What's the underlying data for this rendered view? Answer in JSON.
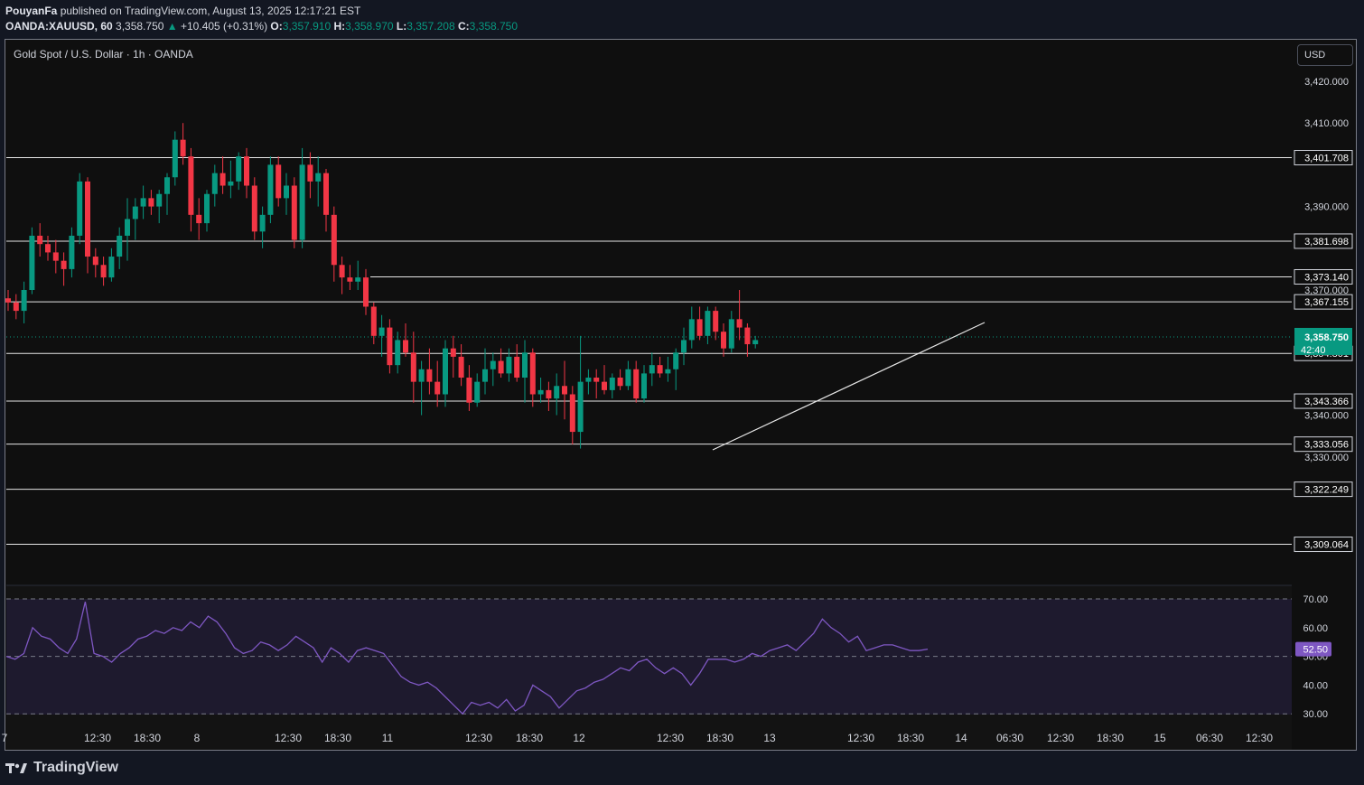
{
  "header": {
    "publisher": "PouyanFa",
    "published_text": "published on TradingView.com, August 13, 2025 12:17:21 EST",
    "symbol": "OANDA:XAUUSD, 60",
    "last": "3,358.750",
    "change": "+10.405 (+0.31%)",
    "o_label": "O:",
    "o": "3,357.910",
    "h_label": "H:",
    "h": "3,358.970",
    "l_label": "L:",
    "l": "3,357.208",
    "c_label": "C:",
    "c": "3,358.750"
  },
  "legend": "Gold Spot / U.S. Dollar · 1h · OANDA",
  "currency_button": "USD",
  "brand": "TradingView",
  "colors": {
    "up": "#089981",
    "down": "#f23645",
    "rsi": "#7e57c2",
    "rsi_badge": "#7e57c2",
    "price_badge": "#089981"
  },
  "chart_data": {
    "type": "candlestick",
    "price_axis": {
      "min": 3300,
      "max": 3428,
      "ticks": [
        "3,420.000",
        "3,410.000",
        "3,390.000",
        "3,370.000",
        "3,340.000",
        "3,330.000"
      ]
    },
    "horizontal_levels": [
      3401.708,
      3381.698,
      3373.14,
      3367.155,
      3354.801,
      3343.366,
      3333.056,
      3322.249,
      3309.064
    ],
    "level_labels": [
      "3,401.708",
      "3,381.698",
      "3,373.140",
      "3,367.155",
      "3,354.801",
      "3,343.366",
      "3,333.056",
      "3,322.249",
      "3,309.064"
    ],
    "last_price": 3358.75,
    "last_price_label": "3,358.750",
    "countdown": "42:40",
    "trendline": {
      "from": [
        "13 18:30",
        3332
      ],
      "to": [
        "14 ~03:00",
        3363
      ]
    },
    "x_ticks": [
      "7",
      "12:30",
      "18:30",
      "8",
      "12:30",
      "18:30",
      "11",
      "12:30",
      "18:30",
      "12",
      "12:30",
      "18:30",
      "13",
      "12:30",
      "18:30",
      "14",
      "06:30",
      "12:30",
      "18:30",
      "15",
      "06:30",
      "12:30"
    ],
    "candles": [
      [
        3368,
        3370,
        3365,
        3367
      ],
      [
        3367,
        3369,
        3363,
        3365
      ],
      [
        3365,
        3372,
        3362,
        3370
      ],
      [
        3370,
        3385,
        3369,
        3383
      ],
      [
        3383,
        3386,
        3378,
        3381
      ],
      [
        3381,
        3383,
        3377,
        3379
      ],
      [
        3379,
        3382,
        3374,
        3377
      ],
      [
        3377,
        3379,
        3371,
        3375
      ],
      [
        3375,
        3385,
        3373,
        3383
      ],
      [
        3383,
        3398,
        3381,
        3396
      ],
      [
        3396,
        3397,
        3374,
        3378
      ],
      [
        3378,
        3380,
        3373,
        3376
      ],
      [
        3376,
        3378,
        3371,
        3373
      ],
      [
        3373,
        3380,
        3372,
        3378
      ],
      [
        3378,
        3385,
        3375,
        3383
      ],
      [
        3383,
        3392,
        3377,
        3387
      ],
      [
        3387,
        3392,
        3382,
        3390
      ],
      [
        3390,
        3395,
        3387,
        3392
      ],
      [
        3392,
        3394,
        3388,
        3390
      ],
      [
        3390,
        3394,
        3386,
        3393
      ],
      [
        3393,
        3398,
        3388,
        3397
      ],
      [
        3397,
        3408,
        3395,
        3406
      ],
      [
        3406,
        3410,
        3400,
        3402
      ],
      [
        3402,
        3404,
        3384,
        3388
      ],
      [
        3388,
        3392,
        3382,
        3386
      ],
      [
        3386,
        3394,
        3384,
        3393
      ],
      [
        3393,
        3400,
        3390,
        3398
      ],
      [
        3398,
        3402,
        3393,
        3395
      ],
      [
        3395,
        3401,
        3392,
        3396
      ],
      [
        3396,
        3403,
        3394,
        3402
      ],
      [
        3402,
        3404,
        3392,
        3395
      ],
      [
        3395,
        3397,
        3382,
        3384
      ],
      [
        3384,
        3390,
        3380,
        3388
      ],
      [
        3388,
        3402,
        3386,
        3400
      ],
      [
        3400,
        3402,
        3390,
        3392
      ],
      [
        3392,
        3398,
        3388,
        3395
      ],
      [
        3395,
        3397,
        3380,
        3382
      ],
      [
        3382,
        3404,
        3380,
        3400
      ],
      [
        3400,
        3403,
        3392,
        3396
      ],
      [
        3396,
        3402,
        3390,
        3398
      ],
      [
        3398,
        3399,
        3384,
        3388
      ],
      [
        3388,
        3390,
        3372,
        3376
      ],
      [
        3376,
        3378,
        3369,
        3373
      ],
      [
        3373,
        3376,
        3370,
        3372
      ],
      [
        3372,
        3377,
        3370,
        3373
      ],
      [
        3373,
        3375,
        3364,
        3366
      ],
      [
        3366,
        3367,
        3357,
        3359
      ],
      [
        3359,
        3364,
        3354,
        3361
      ],
      [
        3361,
        3363,
        3350,
        3352
      ],
      [
        3352,
        3360,
        3350,
        3358
      ],
      [
        3358,
        3362,
        3354,
        3355
      ],
      [
        3355,
        3360,
        3343,
        3348
      ],
      [
        3348,
        3353,
        3340,
        3351
      ],
      [
        3351,
        3356,
        3345,
        3348
      ],
      [
        3348,
        3353,
        3342,
        3345
      ],
      [
        3345,
        3358,
        3342,
        3356
      ],
      [
        3356,
        3359,
        3349,
        3354
      ],
      [
        3354,
        3357,
        3347,
        3349
      ],
      [
        3349,
        3352,
        3341,
        3343
      ],
      [
        3343,
        3350,
        3342,
        3348
      ],
      [
        3348,
        3356,
        3345,
        3351
      ],
      [
        3351,
        3355,
        3347,
        3353
      ],
      [
        3353,
        3356,
        3349,
        3350
      ],
      [
        3350,
        3356,
        3348,
        3354
      ],
      [
        3354,
        3357,
        3348,
        3349
      ],
      [
        3349,
        3358,
        3343,
        3355
      ],
      [
        3355,
        3356,
        3342,
        3345
      ],
      [
        3345,
        3349,
        3343,
        3346
      ],
      [
        3346,
        3348,
        3341,
        3344
      ],
      [
        3344,
        3350,
        3340,
        3347
      ],
      [
        3347,
        3353,
        3339,
        3345
      ],
      [
        3345,
        3347,
        3333,
        3336
      ],
      [
        3336,
        3359,
        3332,
        3348
      ],
      [
        3348,
        3351,
        3345,
        3349
      ],
      [
        3349,
        3351,
        3344,
        3348
      ],
      [
        3348,
        3352,
        3345,
        3346
      ],
      [
        3346,
        3350,
        3344,
        3349
      ],
      [
        3349,
        3351,
        3346,
        3347
      ],
      [
        3347,
        3353,
        3346,
        3351
      ],
      [
        3351,
        3353,
        3343,
        3344
      ],
      [
        3344,
        3352,
        3343,
        3350
      ],
      [
        3350,
        3355,
        3347,
        3352
      ],
      [
        3352,
        3354,
        3349,
        3350
      ],
      [
        3350,
        3354,
        3348,
        3351
      ],
      [
        3351,
        3356,
        3346,
        3355
      ],
      [
        3355,
        3361,
        3352,
        3358
      ],
      [
        3358,
        3366,
        3356,
        3363
      ],
      [
        3363,
        3366,
        3358,
        3359
      ],
      [
        3359,
        3366,
        3357,
        3365
      ],
      [
        3365,
        3366,
        3358,
        3360
      ],
      [
        3360,
        3362,
        3354,
        3356
      ],
      [
        3356,
        3365,
        3355,
        3363
      ],
      [
        3363,
        3370,
        3358,
        3361
      ],
      [
        3361,
        3362,
        3354,
        3357
      ],
      [
        3357,
        3359,
        3356,
        3358
      ]
    ],
    "rsi": {
      "label": "52.50",
      "ticks": [
        "70.00",
        "60.00",
        "50.00",
        "40.00",
        "30.00"
      ],
      "upper": 70,
      "lower": 30,
      "mid": 50,
      "values": [
        50,
        49,
        51,
        60,
        57,
        56,
        53,
        51,
        56,
        69,
        51,
        50,
        48,
        51,
        53,
        56,
        57,
        59,
        58,
        60,
        59,
        62,
        60,
        64,
        62,
        58,
        53,
        51,
        52,
        55,
        54,
        52,
        54,
        57,
        55,
        53,
        48,
        53,
        51,
        48,
        52,
        53,
        52,
        51,
        47,
        43,
        41,
        40,
        41,
        39,
        36,
        33,
        30,
        34,
        33,
        34,
        32,
        35,
        31,
        33,
        40,
        38,
        36,
        32,
        35,
        38,
        39,
        41,
        42,
        44,
        46,
        45,
        48,
        49,
        46,
        44,
        46,
        44,
        40,
        44,
        49,
        49,
        49,
        48,
        49,
        51,
        50,
        52,
        53,
        54,
        52,
        55,
        58,
        63,
        60,
        58,
        55,
        57,
        52,
        53,
        54,
        54,
        53,
        52,
        52,
        52.5
      ]
    }
  }
}
